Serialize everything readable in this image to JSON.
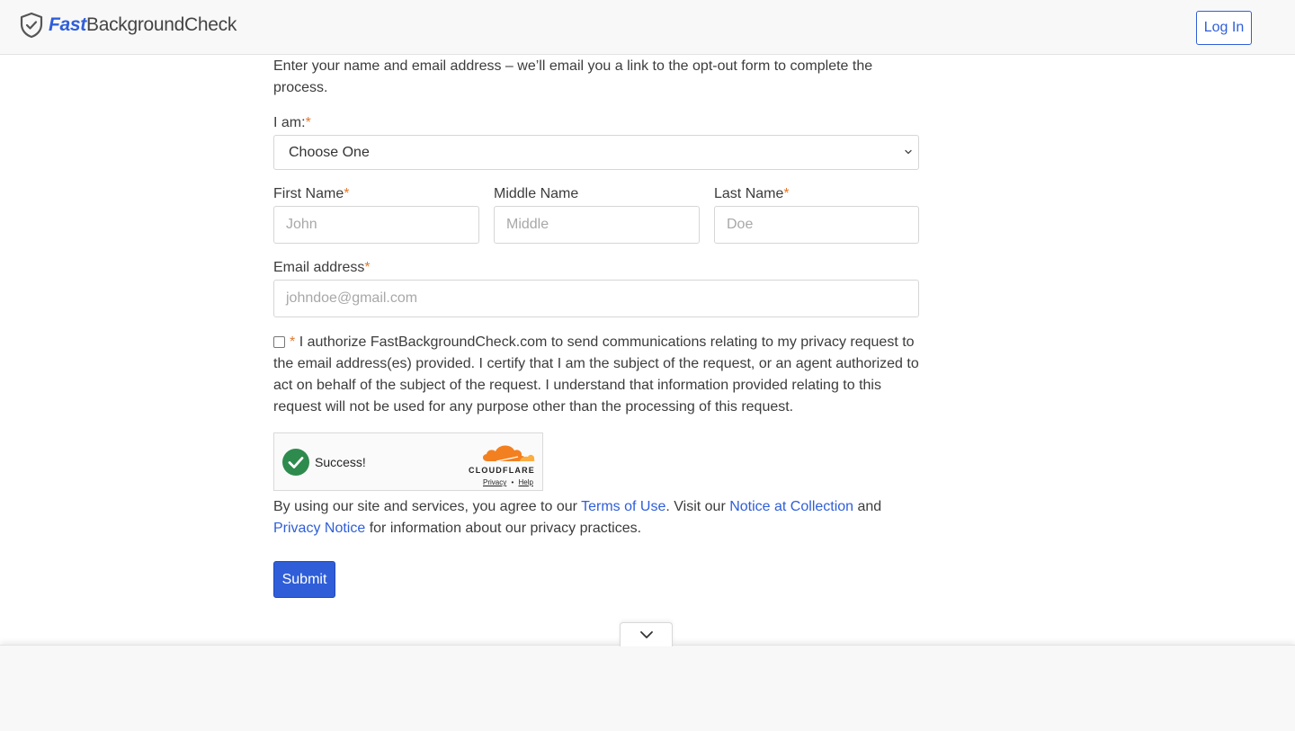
{
  "header": {
    "logo_fast": "Fast",
    "logo_rest": "BackgroundCheck",
    "login_label": "Log In"
  },
  "intro_text": "Enter your name and email address – we’ll email you a link to the opt-out form to complete the process.",
  "form": {
    "required_mark": "*",
    "iam_label": "I am:",
    "iam_selected": "Choose One",
    "first_name_label": "First Name",
    "first_name_placeholder": "John",
    "middle_name_label": "Middle Name",
    "middle_name_placeholder": "Middle",
    "last_name_label": "Last Name",
    "last_name_placeholder": "Doe",
    "email_label": "Email address",
    "email_placeholder": "johndoe@gmail.com",
    "consent_text": "I authorize FastBackgroundCheck.com to send communications relating to my privacy request to the email address(es) provided. I certify that I am the subject of the request, or an agent authorized to act on behalf of the subject of the request. I understand that information provided relating to this request will not be used for any purpose other than the processing of this request.",
    "consent_checked": false
  },
  "captcha": {
    "status": "Success!",
    "brand": "CLOUDFLARE",
    "privacy_link": "Privacy",
    "separator": "•",
    "help_link": "Help"
  },
  "terms": {
    "part1": "By using our site and services, you agree to our ",
    "terms_link": "Terms of Use",
    "part2": ". Visit our ",
    "notice_link": "Notice at Collection",
    "part3": " and ",
    "privacy_link": "Privacy Notice",
    "part4": " for information about our privacy practices."
  },
  "submit_label": "Submit",
  "colors": {
    "accent": "#2f5ed8",
    "required": "#e07a2e",
    "success": "#2e8b4e",
    "cloudflare_orange": "#f38020"
  }
}
